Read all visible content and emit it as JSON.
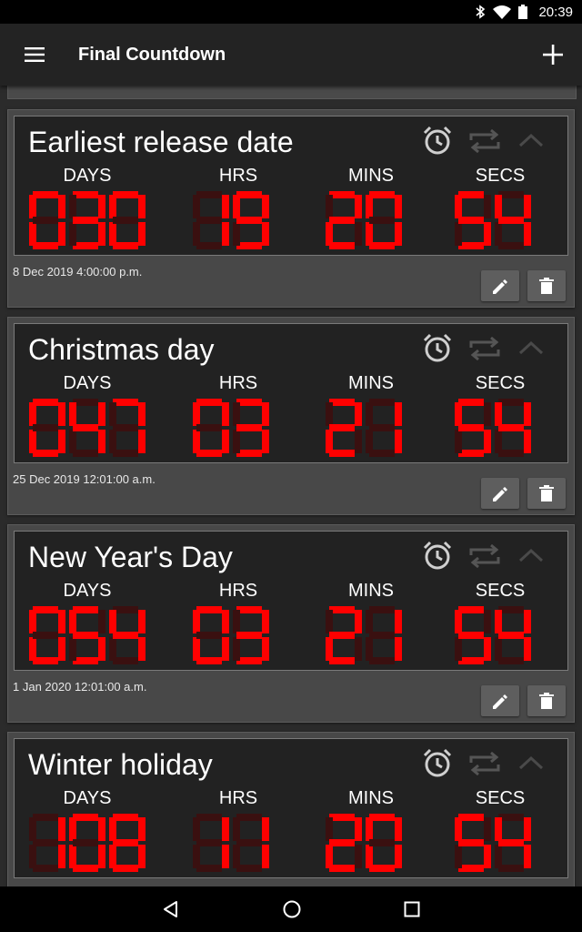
{
  "status": {
    "time": "20:39",
    "icons": [
      "bluetooth-icon",
      "wifi-icon",
      "battery-icon"
    ]
  },
  "appbar": {
    "title": "Final Countdown",
    "menu_icon": "menu-icon",
    "add_icon": "add-icon"
  },
  "labels": {
    "days": "DAYS",
    "hrs": "HRS",
    "mins": "MINS",
    "secs": "SECS"
  },
  "colors": {
    "segment_on": "#ff0000",
    "segment_off": "#3a1010",
    "background": "#2b2b2b"
  },
  "countdowns": [
    {
      "title": "Earliest release date",
      "days": "030",
      "hrs": "19",
      "mins": "20",
      "secs": "54",
      "date": "8 Dec 2019 4:00:00 p.m."
    },
    {
      "title": "Christmas day",
      "days": "047",
      "hrs": "03",
      "mins": "21",
      "secs": "54",
      "date": "25 Dec 2019 12:01:00 a.m."
    },
    {
      "title": "New Year's Day",
      "days": "054",
      "hrs": "03",
      "mins": "21",
      "secs": "54",
      "date": "1 Jan 2020 12:01:00 a.m."
    },
    {
      "title": "Winter holiday",
      "days": "108",
      "hrs": "11",
      "mins": "20",
      "secs": "54",
      "date": ""
    }
  ],
  "nav": {
    "icons": [
      "back-icon",
      "home-icon",
      "recents-icon"
    ]
  }
}
